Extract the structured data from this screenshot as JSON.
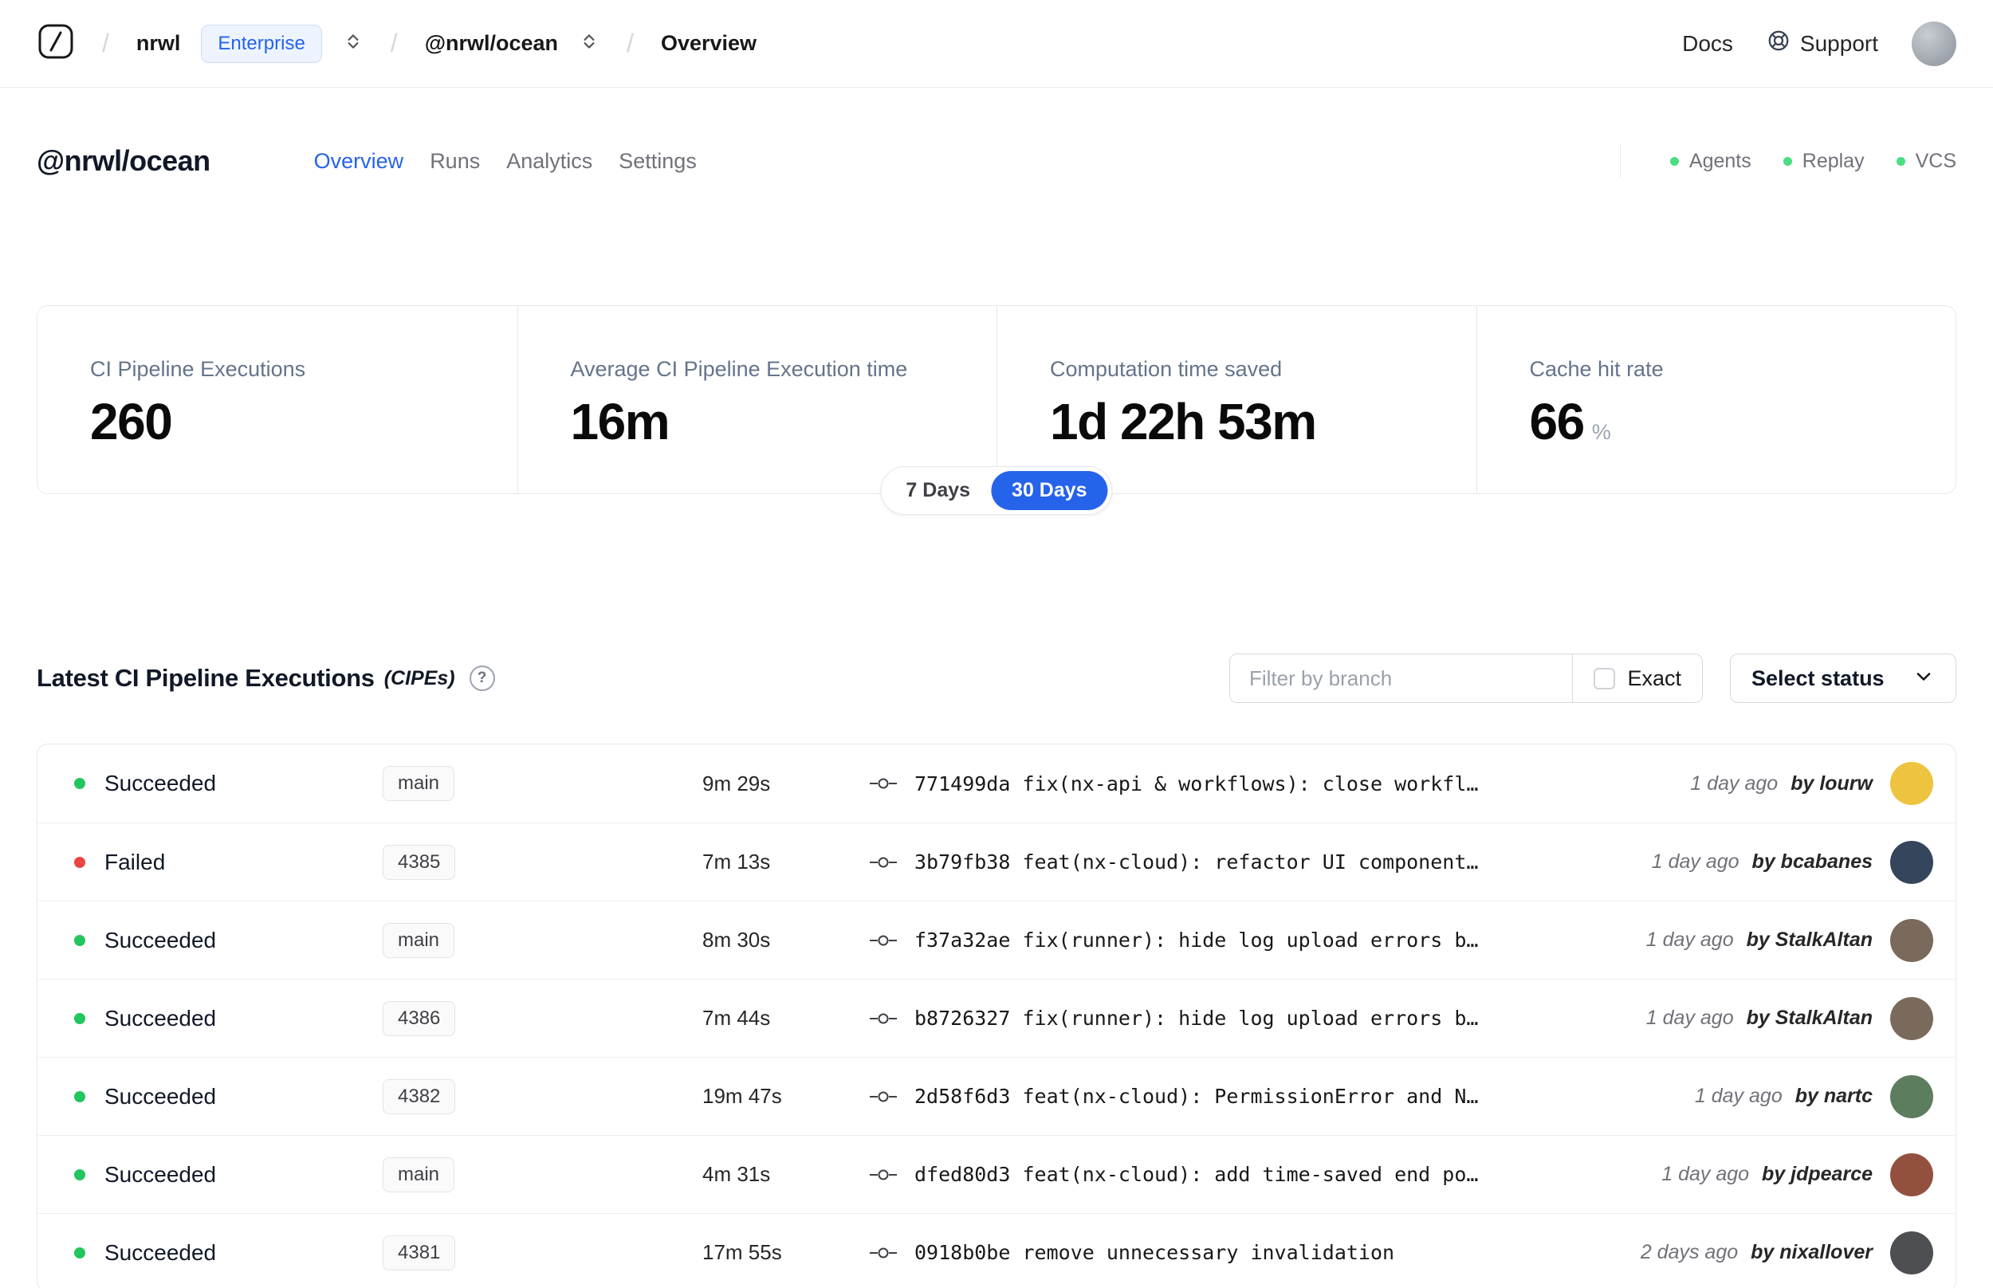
{
  "topbar": {
    "breadcrumb": {
      "org": "nrwl",
      "org_badge": "Enterprise",
      "workspace": "@nrwl/ocean",
      "page": "Overview"
    },
    "docs_label": "Docs",
    "support_label": "Support"
  },
  "workspace": {
    "title": "@nrwl/ocean",
    "tabs": [
      {
        "label": "Overview",
        "active": true
      },
      {
        "label": "Runs",
        "active": false
      },
      {
        "label": "Analytics",
        "active": false
      },
      {
        "label": "Settings",
        "active": false
      }
    ],
    "integrations": [
      {
        "label": "Agents",
        "status_color": "#4ade80"
      },
      {
        "label": "Replay",
        "status_color": "#4ade80"
      },
      {
        "label": "VCS",
        "status_color": "#4ade80"
      }
    ]
  },
  "stats": {
    "cards": [
      {
        "label": "CI Pipeline Executions",
        "value": "260"
      },
      {
        "label": "Average CI Pipeline Execution time",
        "value": "16m"
      },
      {
        "label": "Computation time saved",
        "value": "1d 22h 53m"
      },
      {
        "label": "Cache hit rate",
        "value": "66",
        "unit": "%"
      }
    ],
    "range_toggle": {
      "options": [
        "7 Days",
        "30 Days"
      ],
      "active": "30 Days"
    }
  },
  "cipes": {
    "title": "Latest CI Pipeline Executions",
    "subtitle": "(CIPEs)",
    "help": "?",
    "filter_placeholder": "Filter by branch",
    "exact_label": "Exact",
    "status_select_label": "Select status",
    "rows": [
      {
        "status": "Succeeded",
        "status_color": "#22c55e",
        "branch": "main",
        "duration": "9m 29s",
        "commit_hash": "771499da",
        "commit_message": "fix(nx-api & workflows): close workfl…",
        "time_ago": "1 day ago",
        "author": "by lourw",
        "avatar_color": "#eec33f"
      },
      {
        "status": "Failed",
        "status_color": "#ef4444",
        "branch": "4385",
        "duration": "7m 13s",
        "commit_hash": "3b79fb38",
        "commit_message": "feat(nx-cloud): refactor UI component…",
        "time_ago": "1 day ago",
        "author": "by bcabanes",
        "avatar_color": "#35455c"
      },
      {
        "status": "Succeeded",
        "status_color": "#22c55e",
        "branch": "main",
        "duration": "8m 30s",
        "commit_hash": "f37a32ae",
        "commit_message": "fix(runner): hide log upload errors b…",
        "time_ago": "1 day ago",
        "author": "by StalkAltan",
        "avatar_color": "#7a6a5c"
      },
      {
        "status": "Succeeded",
        "status_color": "#22c55e",
        "branch": "4386",
        "duration": "7m 44s",
        "commit_hash": "b8726327",
        "commit_message": "fix(runner): hide log upload errors b…",
        "time_ago": "1 day ago",
        "author": "by StalkAltan",
        "avatar_color": "#7a6a5c"
      },
      {
        "status": "Succeeded",
        "status_color": "#22c55e",
        "branch": "4382",
        "duration": "19m 47s",
        "commit_hash": "2d58f6d3",
        "commit_message": "feat(nx-cloud): PermissionError and N…",
        "time_ago": "1 day ago",
        "author": "by nartc",
        "avatar_color": "#5d7d5f"
      },
      {
        "status": "Succeeded",
        "status_color": "#22c55e",
        "branch": "main",
        "duration": "4m 31s",
        "commit_hash": "dfed80d3",
        "commit_message": "feat(nx-cloud): add time-saved end po…",
        "time_ago": "1 day ago",
        "author": "by jdpearce",
        "avatar_color": "#94503e"
      },
      {
        "status": "Succeeded",
        "status_color": "#22c55e",
        "branch": "4381",
        "duration": "17m 55s",
        "commit_hash": "0918b0be",
        "commit_message": "remove unnecessary invalidation",
        "time_ago": "2 days ago",
        "author": "by nixallover",
        "avatar_color": "#4d4f52"
      }
    ]
  }
}
